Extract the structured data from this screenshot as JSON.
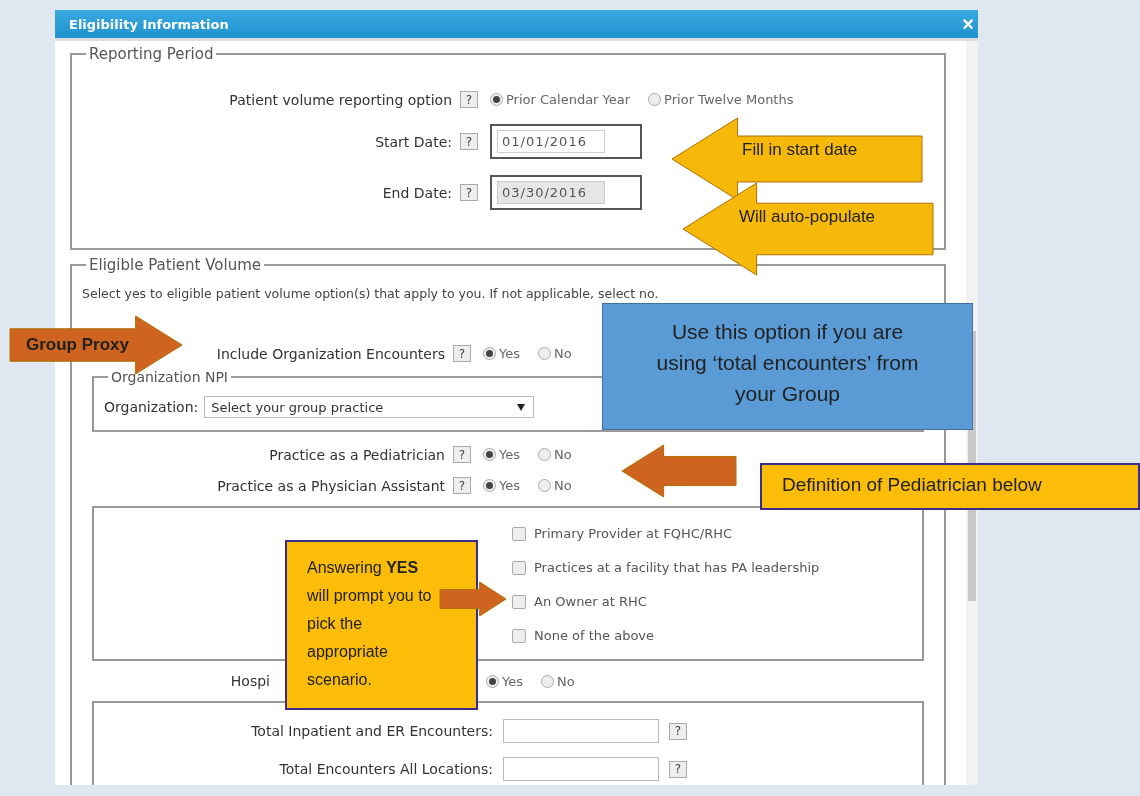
{
  "dialog": {
    "title": "Eligibility Information",
    "close": "×"
  },
  "reporting_period": {
    "legend": "Reporting Period",
    "option": {
      "label": "Patient volume reporting option",
      "help": "?",
      "choices": [
        {
          "label": "Prior Calendar Year",
          "selected": true
        },
        {
          "label": "Prior Twelve Months",
          "selected": false
        }
      ]
    },
    "dates": [
      {
        "label": "Start Date:",
        "help": "?",
        "value": "01/01/2016",
        "disabled": false
      },
      {
        "label": "End Date:",
        "help": "?",
        "value": "03/30/2016",
        "disabled": true
      }
    ]
  },
  "eligible_patient_volume": {
    "legend": "Eligible Patient Volume",
    "instruction": "Select yes to eligible patient volume option(s) that apply to you. If not applicable, select no.",
    "organization_encounters": {
      "label": "Include Organization Encounters",
      "help": "?",
      "choices": [
        {
          "label": "Yes",
          "selected": true
        },
        {
          "label": "No",
          "selected": false
        }
      ]
    },
    "organization_npi": {
      "legend": "Organization NPI",
      "label": "Organization:",
      "select": "Select your group practice"
    },
    "questions": [
      {
        "label": "Practice as a Pediatrician",
        "help": "?",
        "choices": [
          {
            "label": "Yes",
            "selected": true
          },
          {
            "label": "No",
            "selected": false
          }
        ]
      },
      {
        "label": "Practice as a Physician Assistant",
        "help": "?",
        "choices": [
          {
            "label": "Yes",
            "selected": true
          },
          {
            "label": "No",
            "selected": false
          }
        ]
      }
    ],
    "pa_scenarios": [
      {
        "label": "Primary Provider at FQHC/RHC",
        "checked": false
      },
      {
        "label": "Practices at a facility that has PA leadership",
        "checked": false
      },
      {
        "label": "An Owner at RHC",
        "checked": false
      },
      {
        "label": "None of the above",
        "checked": false
      }
    ],
    "hospital": {
      "label": "Hospi",
      "choices": [
        {
          "label": "Yes",
          "selected": true
        },
        {
          "label": "No",
          "selected": false
        }
      ]
    },
    "encounter_fields": [
      {
        "label": "Total Inpatient and ER Encounters:",
        "help": "?"
      },
      {
        "label": "Total Encounters All Locations:",
        "help": "?"
      }
    ]
  },
  "annotations": [
    {
      "kind": "arrow_left",
      "text": "Fill in start date",
      "color": "#f6b90a"
    },
    {
      "kind": "arrow_left",
      "text": "Will auto-populate",
      "color": "#f6b90a"
    },
    {
      "kind": "arrow_right",
      "text": "Group Proxy",
      "color": "#cf6420"
    },
    {
      "kind": "box",
      "text": "Use this option if you are using ‘total encounters’ from your Group",
      "color": "#5b9bd5"
    },
    {
      "kind": "arrow_left",
      "color": "#cf6420"
    },
    {
      "kind": "box",
      "text": "Definition of Pediatrician below",
      "color": "#fbbd08"
    },
    {
      "kind": "box",
      "text": "Answering **YES** will prompt you to pick the appropriate scenario.",
      "color": "#fbbd08"
    },
    {
      "kind": "arrow_right",
      "color": "#cf6420"
    }
  ]
}
